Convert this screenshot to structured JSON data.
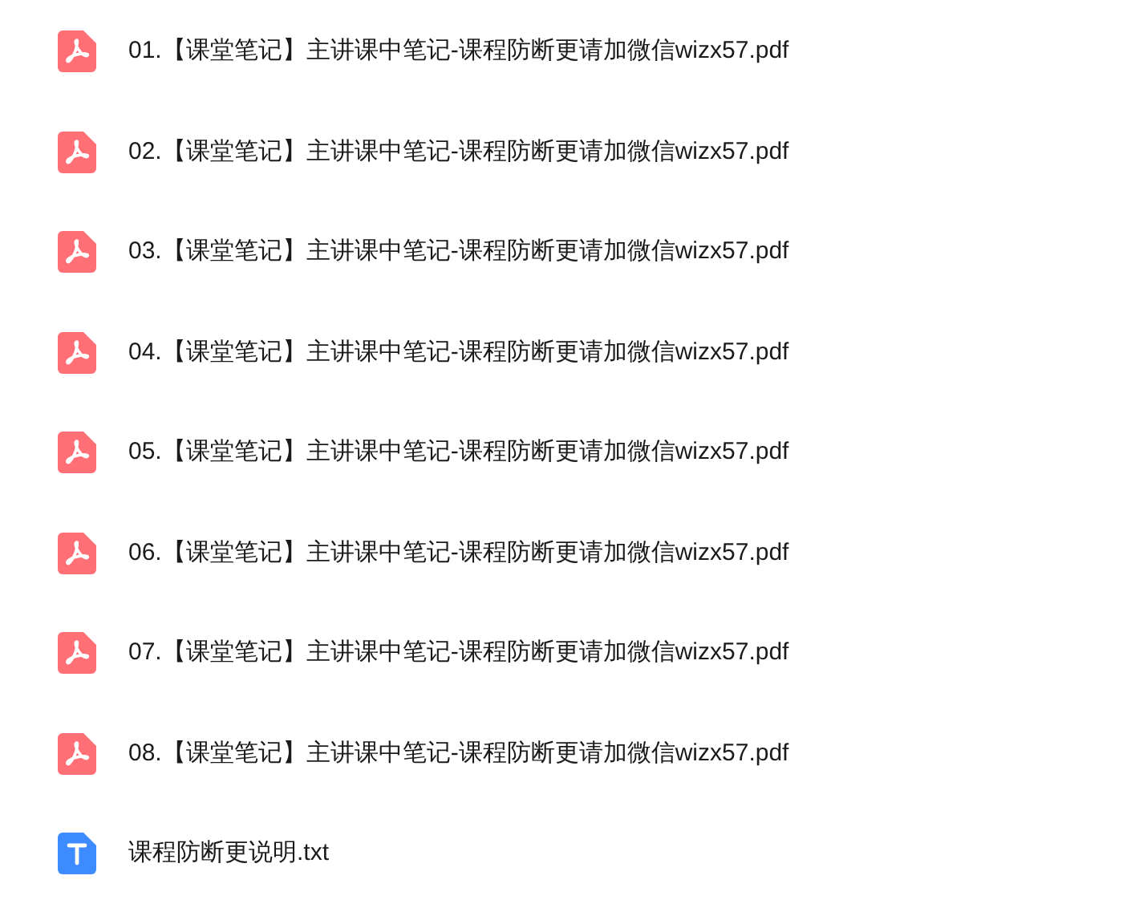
{
  "files": [
    {
      "kind": "pdf",
      "name": "01.【课堂笔记】主讲课中笔记-课程防断更请加微信wizx57.pdf"
    },
    {
      "kind": "pdf",
      "name": "02.【课堂笔记】主讲课中笔记-课程防断更请加微信wizx57.pdf"
    },
    {
      "kind": "pdf",
      "name": "03.【课堂笔记】主讲课中笔记-课程防断更请加微信wizx57.pdf"
    },
    {
      "kind": "pdf",
      "name": "04.【课堂笔记】主讲课中笔记-课程防断更请加微信wizx57.pdf"
    },
    {
      "kind": "pdf",
      "name": "05.【课堂笔记】主讲课中笔记-课程防断更请加微信wizx57.pdf"
    },
    {
      "kind": "pdf",
      "name": "06.【课堂笔记】主讲课中笔记-课程防断更请加微信wizx57.pdf"
    },
    {
      "kind": "pdf",
      "name": "07.【课堂笔记】主讲课中笔记-课程防断更请加微信wizx57.pdf"
    },
    {
      "kind": "pdf",
      "name": "08.【课堂笔记】主讲课中笔记-课程防断更请加微信wizx57.pdf"
    },
    {
      "kind": "txt",
      "name": "课程防断更说明.txt"
    }
  ]
}
